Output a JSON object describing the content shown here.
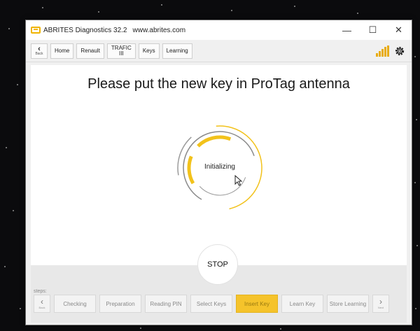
{
  "window": {
    "title": "ABRITES Diagnostics 32.2",
    "url": "www.abrites.com",
    "controls": {
      "minimize": "—",
      "maximize": "☐",
      "close": "✕"
    }
  },
  "toolbar": {
    "back": {
      "label": "Back",
      "icon": "chevron-left-icon"
    },
    "breadcrumbs": [
      "Home",
      "Renault",
      "TRAFIC\nIII",
      "Keys",
      "Learning"
    ],
    "signal_icon": "signal-bars-icon",
    "settings_icon": "gear-icon"
  },
  "main": {
    "prompt": "Please put the new key in ProTag antenna",
    "status": "Initializing",
    "stop_label": "STOP"
  },
  "steps": {
    "label": "steps:",
    "prev_label": "Back",
    "next_label": "Next",
    "items": [
      "Checking",
      "Preparation",
      "Reading PIN",
      "Select Keys",
      "Insert Key",
      "Learn Key",
      "Store Learning"
    ],
    "active": "Insert Key"
  },
  "colors": {
    "accent": "#f5c32b",
    "spinner_yellow": "#f2c21b",
    "spinner_gray": "#8a8a8a"
  }
}
